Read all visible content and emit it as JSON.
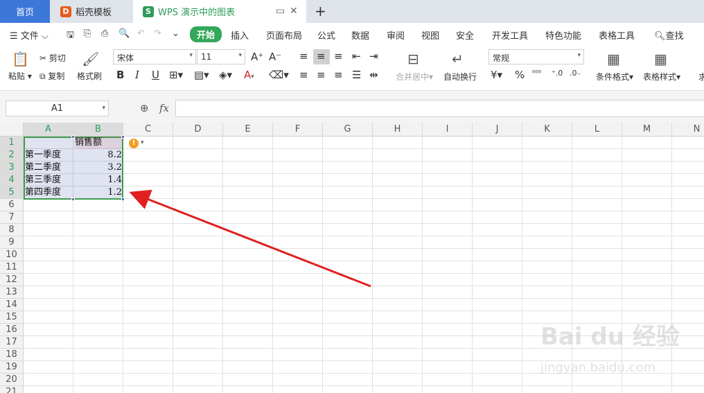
{
  "tabs": {
    "home": "首页",
    "template": "稻壳模板",
    "doc": "WPS 演示中的图表",
    "template_icon": "D",
    "doc_icon": "S"
  },
  "menu": {
    "file": "文件",
    "items": [
      "开始",
      "插入",
      "页面布局",
      "公式",
      "数据",
      "审阅",
      "视图",
      "安全",
      "开发工具",
      "特色功能",
      "表格工具"
    ],
    "search": "查找"
  },
  "ribbon": {
    "paste": "粘贴",
    "cut": "剪切",
    "copy": "复制",
    "format_painter": "格式刷",
    "font_name": "宋体",
    "font_size": "11",
    "merge_center": "合并居中",
    "wrap_text": "自动换行",
    "number_format": "常规",
    "conditional_format": "条件格式",
    "table_style": "表格样式",
    "sum_partial": "求"
  },
  "formula_bar": {
    "name_box": "A1",
    "fx": "fx",
    "value": ""
  },
  "sheet": {
    "columns": [
      "A",
      "B",
      "C",
      "D",
      "E",
      "F",
      "G",
      "H",
      "I",
      "J",
      "K",
      "L",
      "M",
      "N"
    ],
    "rows": [
      "1",
      "2",
      "3",
      "4",
      "5",
      "6",
      "7",
      "8",
      "9",
      "10",
      "11",
      "12",
      "13",
      "14",
      "15",
      "16",
      "17",
      "18",
      "19",
      "20",
      "21"
    ],
    "cells": {
      "A1": "",
      "B1": "销售额",
      "A2": "第一季度",
      "B2": "8.2",
      "A3": "第二季度",
      "B3": "3.2",
      "A4": "第三季度",
      "B4": "1.4",
      "A5": "第四季度",
      "B5": "1.2"
    },
    "arrow_color": "#e02020",
    "selection_color": "#3c9c4c"
  },
  "watermark": {
    "line1": "Bai du 经验",
    "line2": "jingyan.baidu.com"
  }
}
